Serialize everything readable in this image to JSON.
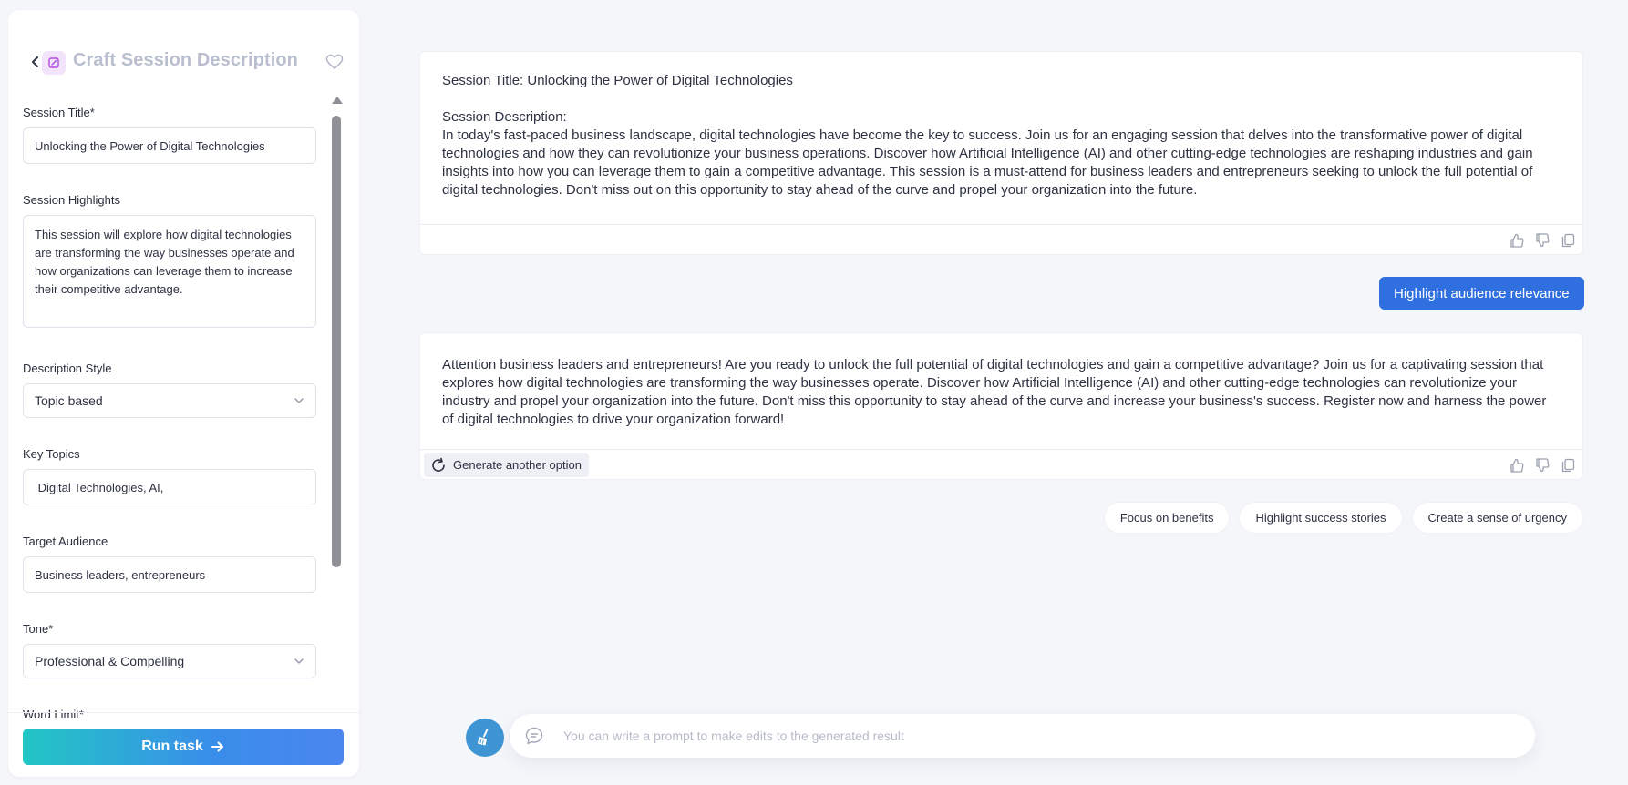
{
  "panel": {
    "title": "Craft Session Description",
    "fields": {
      "session_title": {
        "label": "Session Title*",
        "value": "Unlocking the Power of Digital Technologies"
      },
      "session_highlights": {
        "label": "Session Highlights",
        "value": "This session will explore how digital technologies are transforming the way businesses operate and how organizations can leverage them to increase their competitive advantage."
      },
      "description_style": {
        "label": "Description Style",
        "value": "Topic based"
      },
      "key_topics": {
        "label": "Key Topics",
        "value": " Digital Technologies, AI,"
      },
      "target_audience": {
        "label": "Target Audience",
        "value": "Business leaders, entrepreneurs"
      },
      "tone": {
        "label": "Tone*",
        "value": "Professional & Compelling"
      },
      "word_limit": {
        "label": "Word Limit*"
      }
    },
    "run_button": "Run task"
  },
  "main": {
    "result1": {
      "title_line": "Session Title: Unlocking the Power of Digital Technologies",
      "desc_label": "Session Description:",
      "desc_text": "In today's fast-paced business landscape, digital technologies have become the key to success. Join us for an engaging session that delves into the transformative power of digital technologies and how they can revolutionize your business operations. Discover how Artificial Intelligence (AI) and other cutting-edge technologies are reshaping industries and gain insights into how you can leverage them to gain a competitive advantage. This session is a must-attend for business leaders and entrepreneurs seeking to unlock the full potential of digital technologies. Don't miss out on this opportunity to stay ahead of the curve and propel your organization into the future."
    },
    "user_message": "Highlight audience relevance",
    "result2": {
      "text": "Attention business leaders and entrepreneurs! Are you ready to unlock the full potential of digital technologies and gain a competitive advantage? Join us for a captivating session that explores how digital technologies are transforming the way businesses operate. Discover how Artificial Intelligence (AI) and other cutting-edge technologies can revolutionize your industry and propel your organization into the future. Don't miss this opportunity to stay ahead of the curve and increase your business's success. Register now and harness the power of digital technologies to drive your organization forward!",
      "regenerate": "Generate another option"
    },
    "suggestions": [
      "Focus on benefits",
      "Highlight success stories",
      "Create a sense of urgency"
    ],
    "prompt": {
      "placeholder": "You can write a prompt to make edits to the generated result"
    }
  },
  "colors": {
    "accent": "#2f6fdf",
    "run_gradient_start": "#22c6c5",
    "run_gradient_end": "#4a86ee",
    "broom_button": "#3f95d4"
  },
  "icons": [
    "back-arrow-icon",
    "edit-task-icon",
    "heart-icon",
    "chevron-down-icon",
    "thumbs-up-icon",
    "thumbs-down-icon",
    "copy-icon",
    "refresh-icon",
    "arrow-right-icon",
    "broom-icon",
    "chat-bubble-icon"
  ]
}
